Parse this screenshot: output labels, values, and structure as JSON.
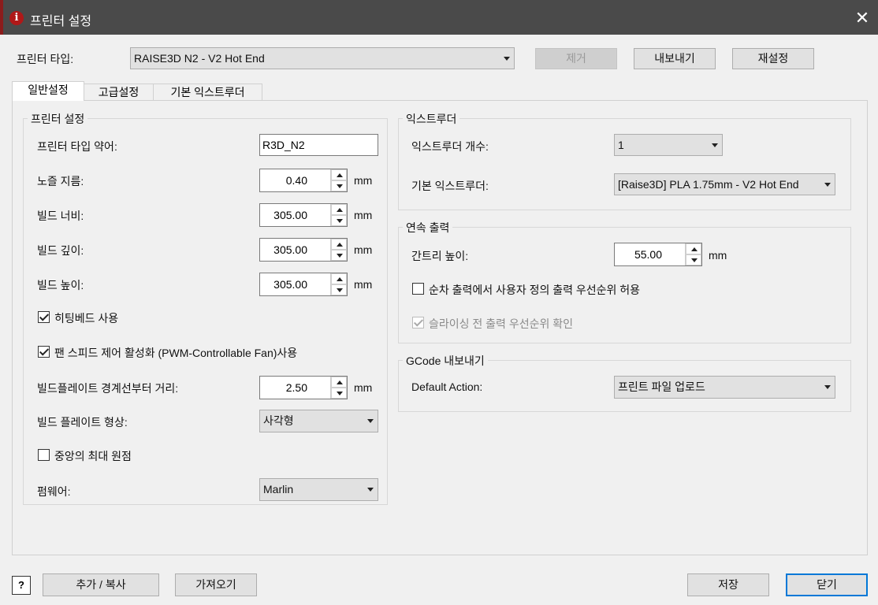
{
  "window": {
    "title": "프린터 설정"
  },
  "printer_type": {
    "label": "프린터 타입:",
    "selected": "RAISE3D N2 - V2 Hot End",
    "remove_label": "제거",
    "export_label": "내보내기",
    "reset_label": "재설정"
  },
  "tabs": [
    {
      "label": "일반설정",
      "active": true
    },
    {
      "label": "고급설정",
      "active": false
    },
    {
      "label": "기본 익스트루더",
      "active": false
    }
  ],
  "printer_settings": {
    "group_title": "프린터 설정",
    "abbr_label": "프린터 타입 약어:",
    "abbr_value": "R3D_N2",
    "nozzle_label": "노즐 지름:",
    "nozzle_value": "0.40",
    "build_width_label": "빌드 너비:",
    "build_width_value": "305.00",
    "build_depth_label": "빌드 깊이:",
    "build_depth_value": "305.00",
    "build_height_label": "빌드 높이:",
    "build_height_value": "305.00",
    "unit": "mm",
    "heated_bed_label": "히팅베드 사용",
    "heated_bed_checked": true,
    "fan_label": "팬 스피드 제어 활성화 (PWM-Controllable Fan)사용",
    "fan_checked": true,
    "plate_margin_label": "빌드플레이트 경계선부터 거리:",
    "plate_margin_value": "2.50",
    "plate_shape_label": "빌드 플레이트 형상:",
    "plate_shape_value": "사각형",
    "center_origin_label": "중앙의 최대 원점",
    "center_origin_checked": false,
    "firmware_label": "펌웨어:",
    "firmware_value": "Marlin"
  },
  "extruder": {
    "group_title": "익스트루더",
    "count_label": "익스트루더 개수:",
    "count_value": "1",
    "default_label": "기본 익스트루더:",
    "default_value": "[Raise3D] PLA 1.75mm - V2 Hot End"
  },
  "sequential": {
    "group_title": "연속 출력",
    "gantry_label": "간트리 높이:",
    "gantry_value": "55.00",
    "unit": "mm",
    "user_priority_label": "순차 출력에서 사용자 정의 출력 우선순위 허용",
    "user_priority_checked": false,
    "slicing_priority_label": "슬라이싱 전 출력 우선순위 확인",
    "slicing_priority_checked": true
  },
  "gcode_export": {
    "group_title": "GCode 내보내기",
    "default_action_label": "Default Action:",
    "default_action_value": "프린트 파일 업로드"
  },
  "footer": {
    "help_label": "?",
    "add_copy_label": "추가 / 복사",
    "import_label": "가져오기",
    "save_label": "저장",
    "close_label": "닫기"
  }
}
